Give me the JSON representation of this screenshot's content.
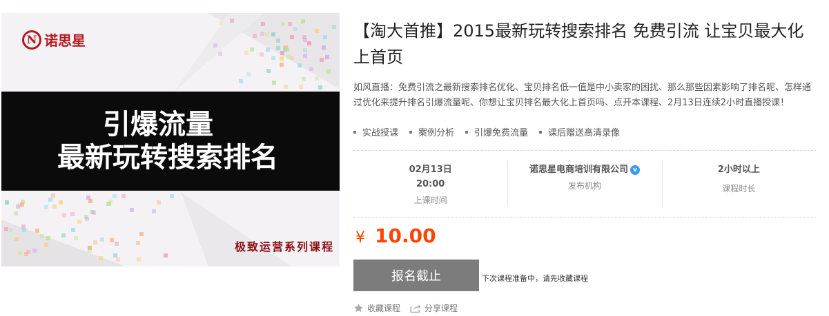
{
  "cover": {
    "logo_mark": "N",
    "logo_text": "诺思星",
    "headline_line1": "引爆流量",
    "headline_line2": "最新玩转搜索排名",
    "series_tag": "极致运营系列课程"
  },
  "course": {
    "title": "【淘大首推】2015最新玩转搜索排名 免费引流 让宝贝最大化上首页",
    "description": "如风直播：免费引流之最新搜索排名优化、宝贝排名低一值是中小卖家的困扰、那么那些因素影响了排名呢、怎样通过优化来提升排名引爆流量呢、你想让宝贝排名最大化上首页吗、点开本课程、2月13日连续2小时直播授课！",
    "tags": [
      "实战授课",
      "案例分析",
      "引爆免费流量",
      "课后赠送高清录像"
    ]
  },
  "info": {
    "date": "02月13日",
    "time": "20:00",
    "time_label": "上课时间",
    "org": "诺思星电商培训有限公司",
    "org_label": "发布机构",
    "duration": "2小时以上",
    "duration_label": "课程时长"
  },
  "price": {
    "currency": "¥",
    "amount": "10.00"
  },
  "enroll": {
    "button_label": "报名截止",
    "note": "下次课程准备中，请先收藏课程"
  },
  "actions": {
    "favorite": "收藏课程",
    "share": "分享课程"
  },
  "colors": {
    "price": "#ff4400",
    "brand": "#b11a1f",
    "button": "#7c7c7c",
    "verified": "#3d9be9"
  }
}
